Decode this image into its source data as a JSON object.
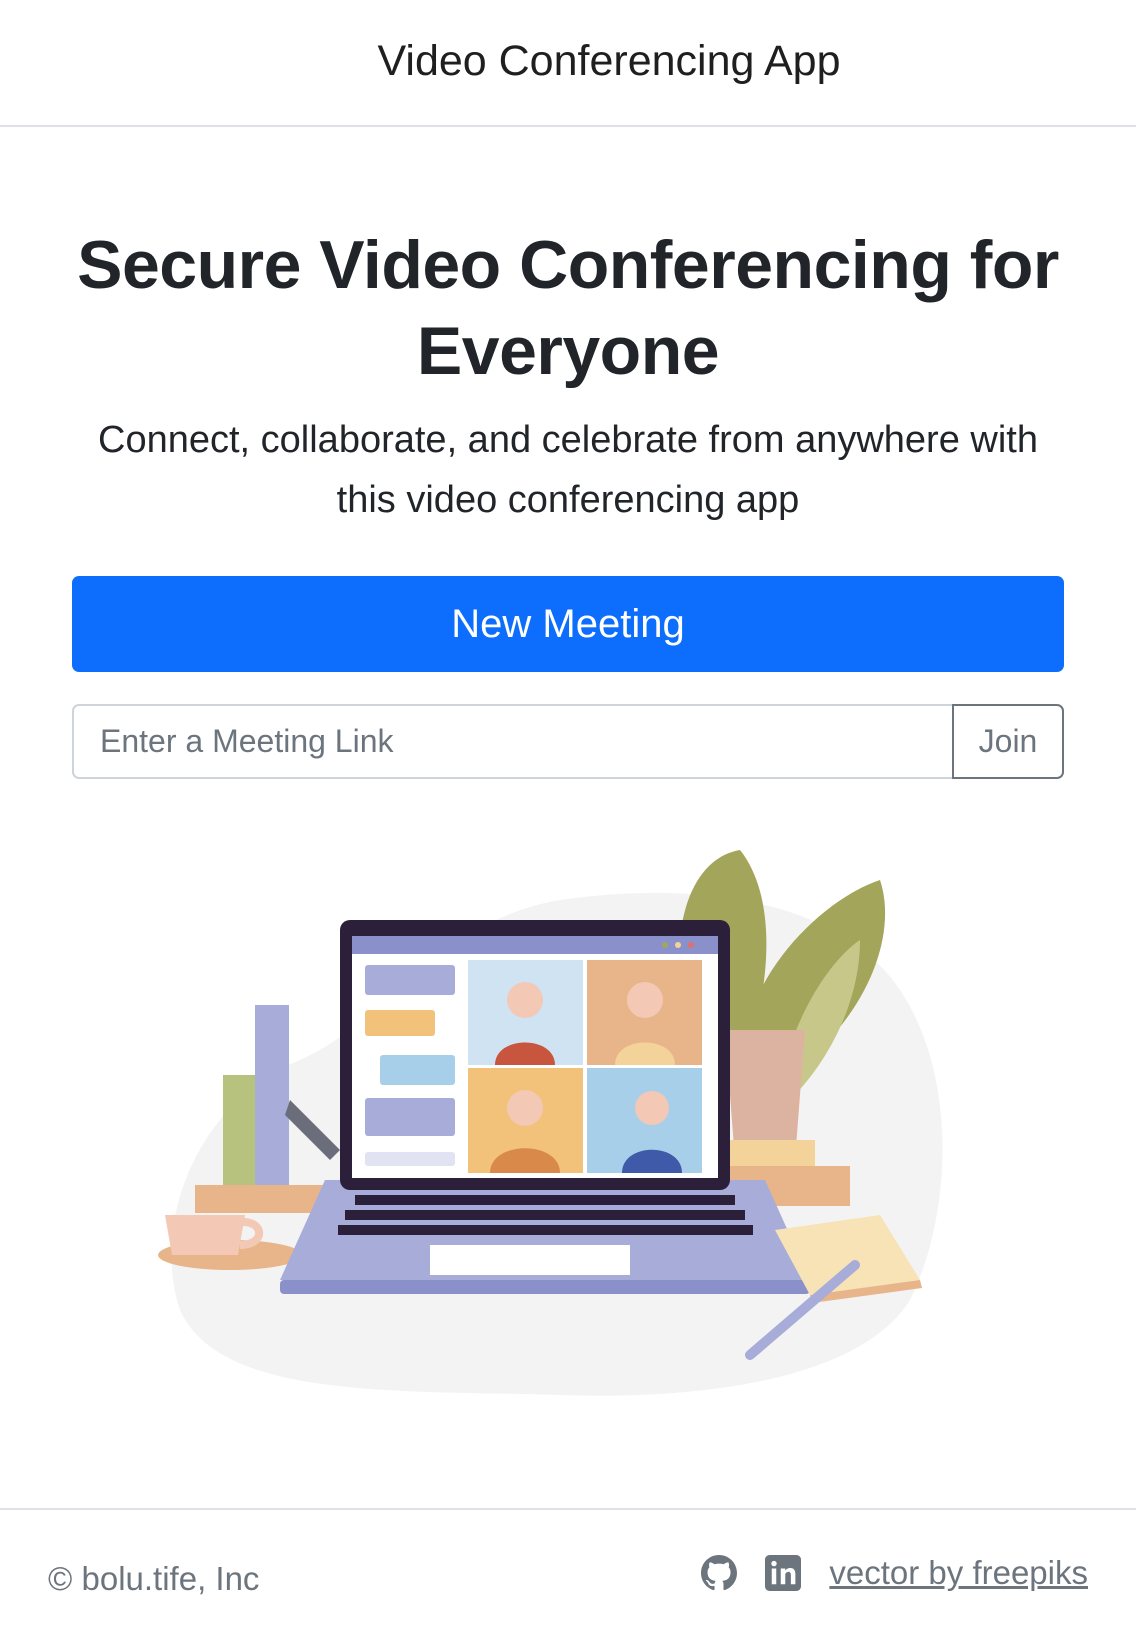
{
  "navbar": {
    "brand": "Video Conferencing App"
  },
  "hero": {
    "title": "Secure Video Conferencing for Everyone",
    "subtitle": "Connect, collaborate, and celebrate from anywhere with this video conferencing app"
  },
  "actions": {
    "new_meeting_label": "New Meeting",
    "link_placeholder": "Enter a Meeting Link",
    "link_value": "",
    "join_label": "Join"
  },
  "footer": {
    "copyright": "© bolu.tife, Inc",
    "icons": [
      "github-icon",
      "linkedin-icon"
    ],
    "credit_link": "vector by freepiks"
  },
  "colors": {
    "primary": "#0d6efd",
    "muted": "#6c757d",
    "border": "#dee2e6"
  }
}
